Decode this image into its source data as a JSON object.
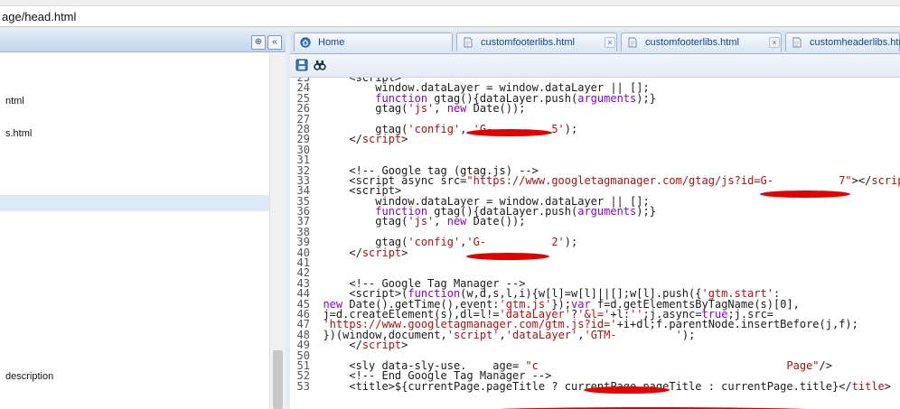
{
  "path": {
    "text": "age/head.html"
  },
  "left_panel": {
    "items": [
      {
        "label": "ntml"
      },
      {
        "label": "s.html"
      },
      {
        "label": "description"
      }
    ],
    "header_buttons": {
      "filter": "⊕",
      "collapse": "«"
    }
  },
  "tabs": [
    {
      "label": "Home",
      "icon": "home-icon"
    },
    {
      "label": "customfooterlibs.html",
      "icon": "file-icon"
    },
    {
      "label": "customfooterlibs.html",
      "icon": "file-icon"
    },
    {
      "label": "customheaderlibs.htm",
      "icon": "file-icon"
    }
  ],
  "toolbar": {
    "icons": [
      "save-icon",
      "find-icon"
    ]
  },
  "code_lines": [
    {
      "n": "23",
      "segs": [
        [
          "t",
          "    <script>"
        ]
      ]
    },
    {
      "n": "24",
      "segs": [
        [
          "t",
          "        window.dataLayer = window.dataLayer || [];"
        ]
      ]
    },
    {
      "n": "25",
      "segs": [
        [
          "t",
          "        "
        ],
        [
          "k",
          "function"
        ],
        [
          "t",
          " gtag(){dataLayer.push("
        ],
        [
          "k",
          "arguments"
        ],
        [
          "t",
          ");}"
        ]
      ]
    },
    {
      "n": "26",
      "segs": [
        [
          "t",
          "        gtag("
        ],
        [
          "s",
          "'js'"
        ],
        [
          "t",
          ", "
        ],
        [
          "k",
          "new"
        ],
        [
          "t",
          " Date());"
        ]
      ]
    },
    {
      "n": "27",
      "segs": []
    },
    {
      "n": "28",
      "segs": [
        [
          "t",
          "        gtag("
        ],
        [
          "s",
          "'config'"
        ],
        [
          "t",
          ", "
        ],
        [
          "s",
          "'G-         5'"
        ],
        [
          "t",
          ");"
        ]
      ]
    },
    {
      "n": "29",
      "segs": [
        [
          "t",
          "    </"
        ],
        [
          "s",
          "script"
        ],
        [
          "t",
          ">"
        ]
      ]
    },
    {
      "n": "30",
      "segs": []
    },
    {
      "n": "31",
      "segs": []
    },
    {
      "n": "32",
      "segs": [
        [
          "t",
          "    <!-- Google tag (gtag.js) -->"
        ]
      ]
    },
    {
      "n": "33",
      "segs": [
        [
          "t",
          "    <script async src="
        ],
        [
          "s",
          "\"https://www.googletagmanager.com/gtag/js?id=G-          7\""
        ],
        [
          "t",
          "></"
        ],
        [
          "s",
          "script"
        ],
        [
          "t",
          ">"
        ]
      ]
    },
    {
      "n": "34",
      "segs": [
        [
          "t",
          "    <script>"
        ]
      ]
    },
    {
      "n": "35",
      "segs": [
        [
          "t",
          "        window.dataLayer = window.dataLayer || [];"
        ]
      ]
    },
    {
      "n": "36",
      "segs": [
        [
          "t",
          "        "
        ],
        [
          "k",
          "function"
        ],
        [
          "t",
          " gtag(){dataLayer.push("
        ],
        [
          "k",
          "arguments"
        ],
        [
          "t",
          ");}"
        ]
      ]
    },
    {
      "n": "37",
      "segs": [
        [
          "t",
          "        gtag("
        ],
        [
          "s",
          "'js'"
        ],
        [
          "t",
          ", "
        ],
        [
          "k",
          "new"
        ],
        [
          "t",
          " Date());"
        ]
      ]
    },
    {
      "n": "38",
      "segs": []
    },
    {
      "n": "39",
      "segs": [
        [
          "t",
          "        gtag("
        ],
        [
          "s",
          "'config'"
        ],
        [
          "t",
          ","
        ],
        [
          "s",
          "'G-          2'"
        ],
        [
          "t",
          ");"
        ]
      ]
    },
    {
      "n": "40",
      "segs": [
        [
          "t",
          "    </"
        ],
        [
          "s",
          "script"
        ],
        [
          "t",
          ">"
        ]
      ]
    },
    {
      "n": "41",
      "segs": []
    },
    {
      "n": "42",
      "segs": []
    },
    {
      "n": "43",
      "segs": [
        [
          "t",
          "    <!-- Google Tag Manager -->"
        ]
      ]
    },
    {
      "n": "44",
      "segs": [
        [
          "t",
          "    <script>("
        ],
        [
          "k",
          "function"
        ],
        [
          "t",
          "(w,d,s,l,i){w[l]=w[l]||[];w[l].push({"
        ],
        [
          "s",
          "'gtm.start'"
        ],
        [
          "t",
          ":"
        ]
      ]
    },
    {
      "n": "45",
      "segs": [
        [
          "k",
          "new"
        ],
        [
          "t",
          " Date().getTime(),event:"
        ],
        [
          "s",
          "'gtm.js'"
        ],
        [
          "t",
          "});"
        ],
        [
          "k",
          "var"
        ],
        [
          "t",
          " f=d.getElementsByTagName(s)[0],"
        ]
      ]
    },
    {
      "n": "46",
      "segs": [
        [
          "t",
          "j=d.createElement(s),dl=l!="
        ],
        [
          "s",
          "'dataLayer'"
        ],
        [
          "t",
          "?"
        ],
        [
          "s",
          "'&l='"
        ],
        [
          "t",
          "+l:"
        ],
        [
          "s",
          "''"
        ],
        [
          "t",
          ";j.async="
        ],
        [
          "k",
          "true"
        ],
        [
          "t",
          ";j.src="
        ]
      ]
    },
    {
      "n": "47",
      "segs": [
        [
          "s",
          "'https://www.googletagmanager.com/gtm.js?id='"
        ],
        [
          "t",
          "+i+dl;f.parentNode.insertBefore(j,f);"
        ]
      ]
    },
    {
      "n": "48",
      "segs": [
        [
          "t",
          "})(window,document,"
        ],
        [
          "s",
          "'script'"
        ],
        [
          "t",
          ","
        ],
        [
          "s",
          "'dataLayer'"
        ],
        [
          "t",
          ","
        ],
        [
          "s",
          "'GTM-         '"
        ],
        [
          "t",
          ");"
        ]
      ]
    },
    {
      "n": "49",
      "segs": [
        [
          "t",
          "    </"
        ],
        [
          "s",
          "script"
        ],
        [
          "t",
          ">"
        ]
      ]
    },
    {
      "n": "50",
      "segs": []
    },
    {
      "n": "51",
      "segs": [
        [
          "t",
          "    <sly data-sly-use.    age= "
        ],
        [
          "s",
          "\"c                                      Page\""
        ],
        [
          "t",
          "/>"
        ]
      ]
    },
    {
      "n": "52",
      "segs": [
        [
          "t",
          "    <!-- End Google Tag Manager -->"
        ]
      ]
    },
    {
      "n": "53",
      "segs": [
        [
          "t",
          "    <title>${currentPage.pageTitle ? currentPage.pageTitle : currentPage.title}</"
        ],
        [
          "s",
          "title"
        ],
        [
          "t",
          ">"
        ]
      ]
    }
  ]
}
